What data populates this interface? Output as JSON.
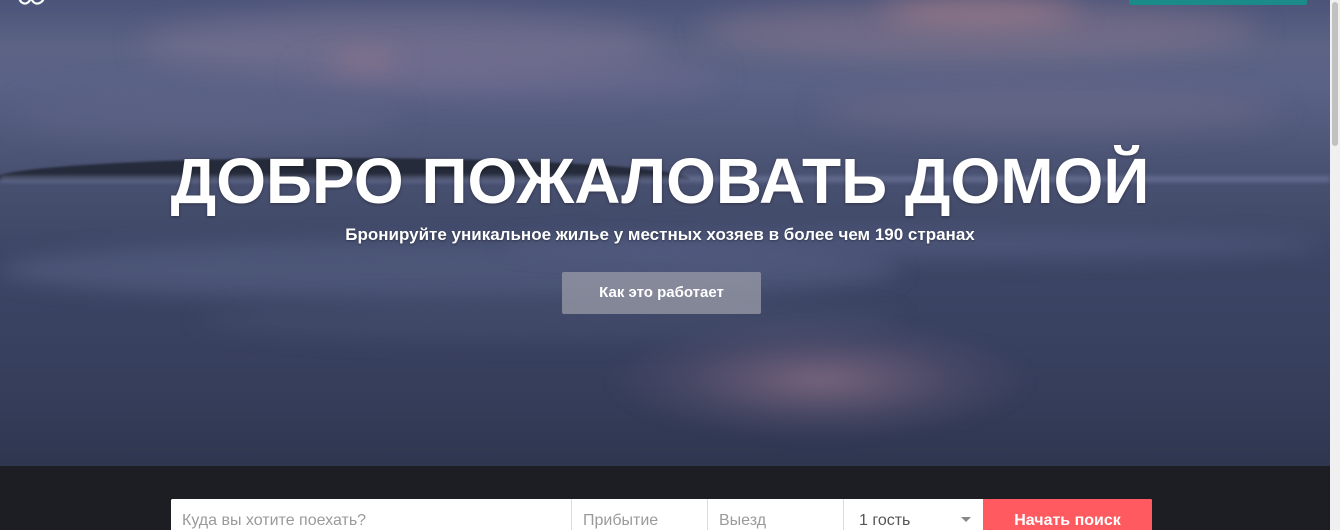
{
  "hero": {
    "title": "ДОБРО ПОЖАЛОВАТЬ ДОМОЙ",
    "subtitle": "Бронируйте уникальное жилье у местных хозяев в более чем 190 странах",
    "how_it_works_label": "Как это работает"
  },
  "header": {
    "logo_icon": "airbnb-belo-icon",
    "accent_color": "#1a8b88"
  },
  "search": {
    "where_placeholder": "Куда вы хотите поехать?",
    "checkin_placeholder": "Прибытие",
    "checkout_placeholder": "Выезд",
    "guests_value": "1 гость",
    "submit_label": "Начать поиск",
    "submit_color": "#ff5a5f"
  }
}
